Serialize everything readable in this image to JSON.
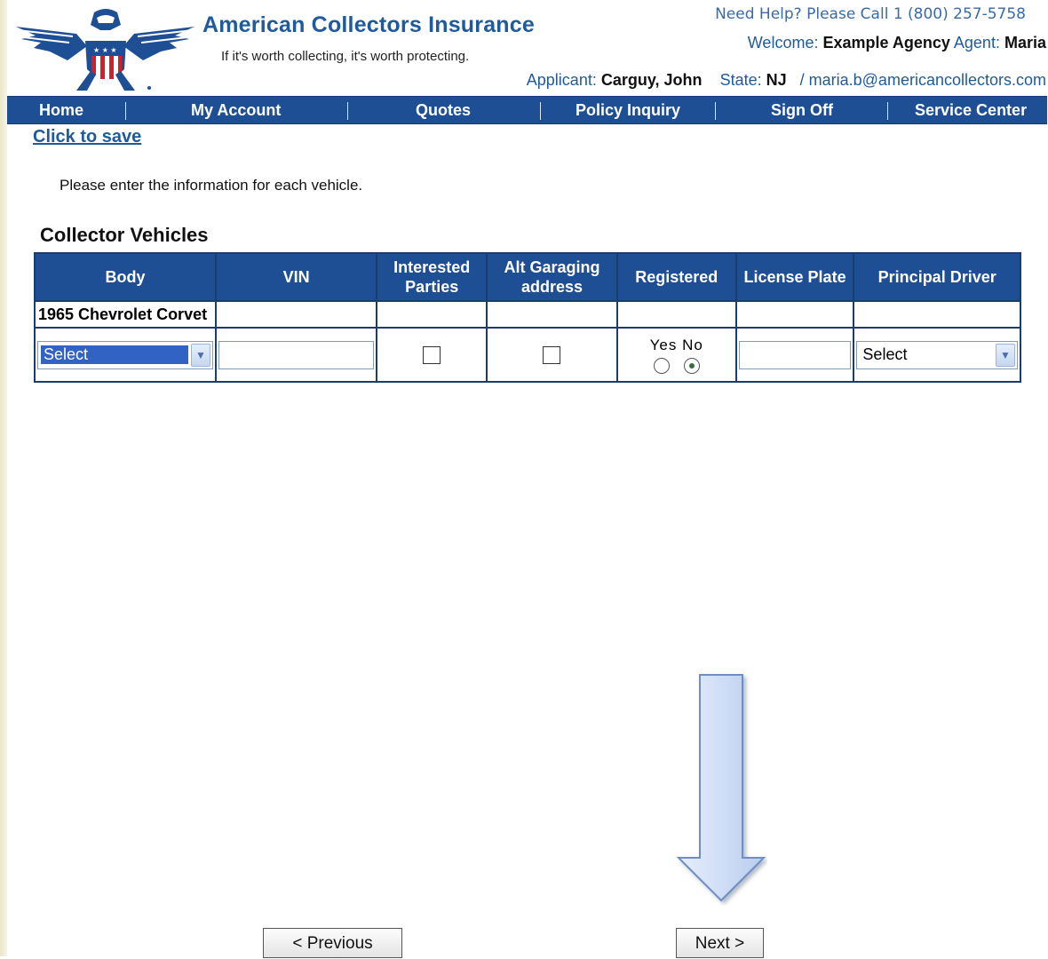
{
  "header": {
    "brand": "American Collectors Insurance",
    "tagline": "If it's worth collecting, it's worth protecting.",
    "help": "Need Help? Please Call 1 (800) 257-5758",
    "welcome_label": "Welcome:",
    "agency": "Example Agency",
    "agent_label": "Agent:",
    "agent": "Maria",
    "applicant_label": "Applicant:",
    "applicant": "Carguy, John",
    "state_label": "State:",
    "state": "NJ",
    "email": "/ maria.b@americancollectors.com"
  },
  "nav": [
    "Home",
    "My Account",
    "Quotes",
    "Policy Inquiry",
    "Sign Off",
    "Service Center"
  ],
  "save_link": "Click to save",
  "instructions": "Please enter the information for each vehicle.",
  "section_title": "Collector Vehicles",
  "table": {
    "headers": [
      "Body",
      "VIN",
      "Interested Parties",
      "Alt Garaging address",
      "Registered",
      "License Plate",
      "Principal Driver"
    ],
    "vehicle_name": "1965 Chevrolet Corvet",
    "body_select": "Select",
    "vin_value": "",
    "registered_yes": "Yes",
    "registered_no": "No",
    "registered_selected": "No",
    "plate_value": "",
    "driver_select": "Select"
  },
  "buttons": {
    "previous": "< Previous",
    "next": "Next >"
  },
  "colors": {
    "nav_blue": "#1e4f95",
    "brand_blue": "#1f5b9c",
    "arrow_fill": "#c9d8f2"
  }
}
